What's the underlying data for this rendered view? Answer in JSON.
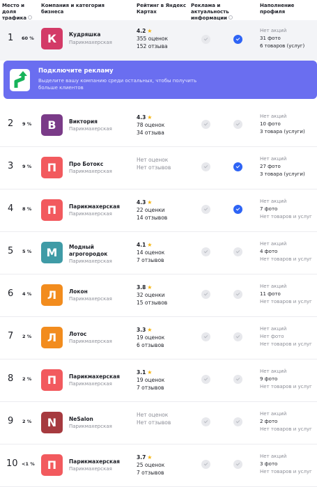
{
  "header": {
    "place_share": "Место и доля трафика",
    "company": "Компания и категория бизнеса",
    "rating": "Рейтинг в Яндекс Картах",
    "ads": "Реклама и актуальность информации",
    "profile": "Наполнение профиля"
  },
  "promo": {
    "title": "Подключите рекламу",
    "text": "Выделите вашу компанию среди остальных, чтобы получить больше клиентов"
  },
  "colors": {
    "accent": "#6a6ef0",
    "check_on": "#2e64f5",
    "star": "#f6b40d"
  },
  "rows": [
    {
      "place": "1",
      "share": "60 %",
      "initial": "К",
      "avatar_color": "#d33a67",
      "name": "Кудряшка",
      "category": "Парикмахерская",
      "rating": "4.2",
      "ratings_count": "355 оценок",
      "reviews": "152 отзыва",
      "ads_checked": false,
      "info_checked": true,
      "promos": "Нет акций",
      "photos": "31 фото",
      "goods": "6 товаров (услуг)"
    },
    {
      "place": "2",
      "share": "9 %",
      "initial": "В",
      "avatar_color": "#7a3b88",
      "name": "Виктория",
      "category": "Парикмахерская",
      "rating": "4.3",
      "ratings_count": "78 оценок",
      "reviews": "34 отзыва",
      "ads_checked": false,
      "info_checked": false,
      "promos": "Нет акций",
      "photos": "10 фото",
      "goods": "3 товара (услуги)"
    },
    {
      "place": "3",
      "share": "9 %",
      "initial": "П",
      "avatar_color": "#f25a5e",
      "name": "Про Ботокс",
      "category": "Парикмахерская",
      "rating": "Нет оценок",
      "ratings_count": "",
      "reviews": "Нет отзывов",
      "ads_checked": false,
      "info_checked": true,
      "promos": "Нет акций",
      "photos": "27 фото",
      "goods": "3 товара (услуги)"
    },
    {
      "place": "4",
      "share": "8 %",
      "initial": "П",
      "avatar_color": "#f25a5e",
      "name": "Парикмахерская",
      "category": "Парикмахерская",
      "rating": "4.3",
      "ratings_count": "22 оценки",
      "reviews": "14 отзывов",
      "ads_checked": false,
      "info_checked": true,
      "promos": "Нет акций",
      "photos": "7 фото",
      "goods": "Нет товаров и услуг"
    },
    {
      "place": "5",
      "share": "5 %",
      "initial": "М",
      "avatar_color": "#3f9ba6",
      "name": "Модный агрогородок",
      "category": "Парикмахерская",
      "rating": "4.1",
      "ratings_count": "14 оценок",
      "reviews": "7 отзывов",
      "ads_checked": false,
      "info_checked": false,
      "promos": "Нет акций",
      "photos": "4 фото",
      "goods": "Нет товаров и услуг"
    },
    {
      "place": "6",
      "share": "4 %",
      "initial": "Л",
      "avatar_color": "#f28c1e",
      "name": "Локон",
      "category": "Парикмахерская",
      "rating": "3.8",
      "ratings_count": "32 оценки",
      "reviews": "15 отзывов",
      "ads_checked": false,
      "info_checked": false,
      "promos": "Нет акций",
      "photos": "11 фото",
      "goods": "Нет товаров и услуг"
    },
    {
      "place": "7",
      "share": "2 %",
      "initial": "Л",
      "avatar_color": "#f28c1e",
      "name": "Лотос",
      "category": "Парикмахерская",
      "rating": "3.3",
      "ratings_count": "19 оценок",
      "reviews": "6 отзывов",
      "ads_checked": false,
      "info_checked": false,
      "promos": "Нет акций",
      "photos": "Нет фото",
      "goods": "Нет товаров и услуг"
    },
    {
      "place": "8",
      "share": "2 %",
      "initial": "П",
      "avatar_color": "#f25a5e",
      "name": "Парикмахерская",
      "category": "Парикмахерская",
      "rating": "3.1",
      "ratings_count": "19 оценок",
      "reviews": "7 отзывов",
      "ads_checked": false,
      "info_checked": false,
      "promos": "Нет акций",
      "photos": "9 фото",
      "goods": "Нет товаров и услуг"
    },
    {
      "place": "9",
      "share": "2 %",
      "initial": "N",
      "avatar_color": "#a63a3f",
      "name": "NeSalon",
      "category": "Парикмахерская",
      "rating": "Нет оценок",
      "ratings_count": "",
      "reviews": "Нет отзывов",
      "ads_checked": false,
      "info_checked": false,
      "promos": "Нет акций",
      "photos": "2 фото",
      "goods": "Нет товаров и услуг"
    },
    {
      "place": "10",
      "share": "<1 %",
      "initial": "П",
      "avatar_color": "#f25a5e",
      "name": "Парикмахерская",
      "category": "Парикмахерская",
      "rating": "3.7",
      "ratings_count": "25 оценок",
      "reviews": "7 отзывов",
      "ads_checked": false,
      "info_checked": false,
      "promos": "Нет акций",
      "photos": "3 фото",
      "goods": "Нет товаров и услуг"
    }
  ]
}
